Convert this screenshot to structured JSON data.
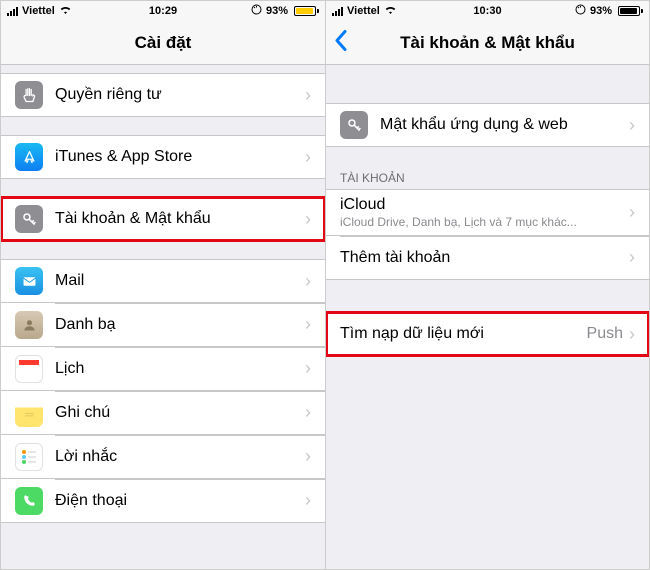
{
  "left": {
    "status": {
      "carrier": "Viettel",
      "time": "10:29",
      "battery_pct": "93%",
      "battery_color": "#ffcc00"
    },
    "header": {
      "title": "Cài đặt"
    },
    "rows": {
      "privacy": "Quyền riêng tư",
      "itunes": "iTunes & App Store",
      "accounts": "Tài khoản & Mật khẩu",
      "mail": "Mail",
      "contacts": "Danh bạ",
      "calendar": "Lịch",
      "notes": "Ghi chú",
      "reminders": "Lời nhắc",
      "phone": "Điện thoại"
    }
  },
  "right": {
    "status": {
      "carrier": "Viettel",
      "time": "10:30",
      "battery_pct": "93%",
      "battery_color": "#000"
    },
    "header": {
      "title": "Tài khoản & Mật khẩu"
    },
    "rows": {
      "app_web_pw": "Mật khẩu ứng dụng & web",
      "section_accounts": "TÀI KHOẢN",
      "icloud": "iCloud",
      "icloud_sub": "iCloud Drive, Danh bạ, Lịch và 7 mục khác...",
      "add_account": "Thêm tài khoản",
      "fetch": "Tìm nạp dữ liệu mới",
      "fetch_value": "Push"
    }
  }
}
